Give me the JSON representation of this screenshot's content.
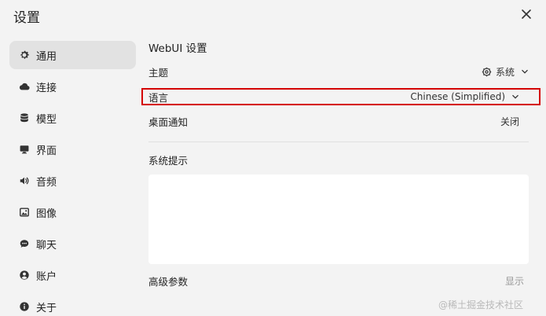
{
  "window": {
    "title": "设置"
  },
  "sidebar": {
    "items": [
      {
        "label": "通用",
        "icon": "gear-icon",
        "active": true
      },
      {
        "label": "连接",
        "icon": "cloud-icon"
      },
      {
        "label": "模型",
        "icon": "database-icon"
      },
      {
        "label": "界面",
        "icon": "monitor-icon"
      },
      {
        "label": "音频",
        "icon": "speaker-icon"
      },
      {
        "label": "图像",
        "icon": "image-icon"
      },
      {
        "label": "聊天",
        "icon": "chat-icon"
      },
      {
        "label": "账户",
        "icon": "user-icon"
      },
      {
        "label": "关于",
        "icon": "info-icon"
      }
    ]
  },
  "main": {
    "section_title": "WebUI 设置",
    "theme": {
      "label": "主题",
      "value": "系统"
    },
    "language": {
      "label": "语言",
      "value": "Chinese (Simplified)"
    },
    "notifications": {
      "label": "桌面通知",
      "value": "关闭"
    },
    "system_prompt": {
      "label": "系统提示",
      "value": ""
    },
    "advanced": {
      "label": "高级参数",
      "toggle": "显示"
    }
  },
  "watermark": "@稀土掘金技术社区",
  "colors": {
    "highlight": "#d40000",
    "active_bg": "#e2e2e2",
    "background": "#f3f3f3"
  }
}
